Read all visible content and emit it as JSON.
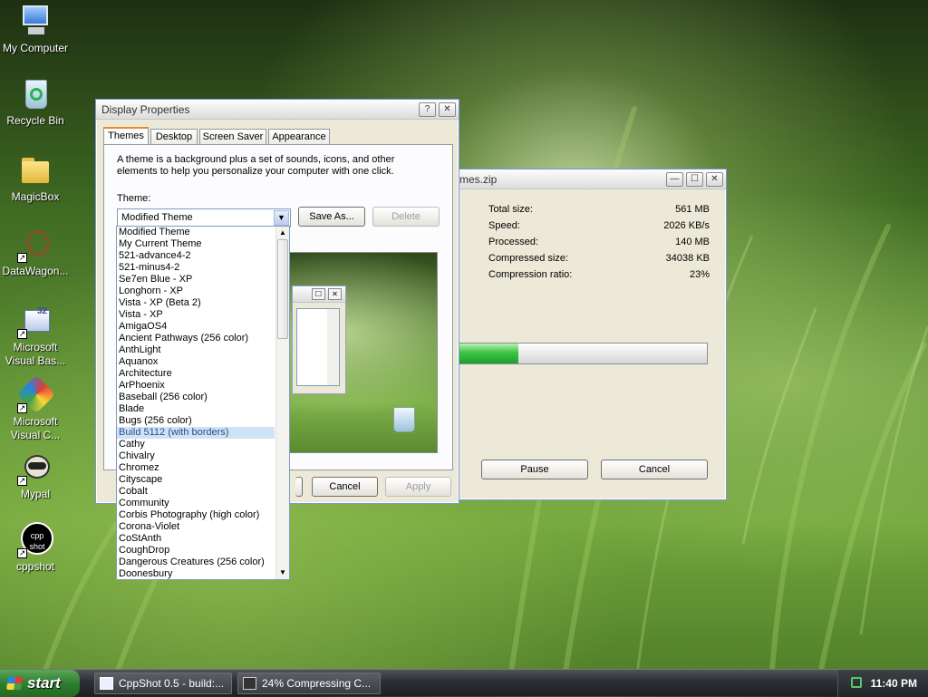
{
  "desktop": {
    "icons": [
      {
        "label": "My Computer"
      },
      {
        "label": "Recycle Bin"
      },
      {
        "label": "MagicBox"
      },
      {
        "label": "DataWagon..."
      },
      {
        "label": "Microsoft Visual Bas..."
      },
      {
        "label": "Microsoft Visual C..."
      },
      {
        "label": "Mypal"
      },
      {
        "label": "cppshot"
      }
    ]
  },
  "compress_window": {
    "title": "mes.zip",
    "stats": [
      {
        "label": "Total size:",
        "value": "561 MB"
      },
      {
        "label": "Speed:",
        "value": "2026 KB/s"
      },
      {
        "label": "Processed:",
        "value": "140 MB"
      },
      {
        "label": "Compressed size:",
        "value": "34038 KB"
      },
      {
        "label": "Compression ratio:",
        "value": "23%"
      }
    ],
    "progress": 0.24,
    "pause_label": "Pause",
    "cancel_label": "Cancel"
  },
  "display_properties": {
    "title": "Display Properties",
    "help_btn": "?",
    "close_btn": "✕",
    "tabs": [
      {
        "label": "Themes",
        "active": true
      },
      {
        "label": "Desktop"
      },
      {
        "label": "Screen Saver"
      },
      {
        "label": "Appearance"
      }
    ],
    "description": "A theme is a background plus a set of sounds, icons, and other elements to help you personalize your computer with one click.",
    "theme_label": "Theme:",
    "theme_selected": "Modified Theme",
    "save_as_label": "Save As...",
    "delete_label": "Delete",
    "cancel_label": "Cancel",
    "apply_label": "Apply",
    "theme_options": [
      "Modified Theme",
      "My Current Theme",
      "521-advance4-2",
      "521-minus4-2",
      "Se7en Blue - XP",
      "Longhorn - XP",
      "Vista - XP (Beta 2)",
      "Vista - XP",
      "AmigaOS4",
      "Ancient Pathways (256 color)",
      "AnthLight",
      "Aquanox",
      "Architecture",
      "ArPhoenix",
      "Baseball (256 color)",
      "Blade",
      "Bugs (256 color)",
      "Build 5112 (with borders)",
      "Cathy",
      "Chivalry",
      "Chromez",
      "Cityscape",
      "Cobalt",
      "Community",
      "Corbis Photography (high color)",
      "Corona-Violet",
      "CoStAnth",
      "CoughDrop",
      "Dangerous Creatures (256 color)",
      "Doonesbury"
    ],
    "highlighted_index": 17
  },
  "taskbar": {
    "start_label": "start",
    "tasks": [
      {
        "label": "CppShot 0.5 - build:..."
      },
      {
        "label": "24% Compressing C..."
      }
    ],
    "clock": "11:40 PM"
  },
  "colors": {
    "progress_fill": "#3cc447",
    "selection": "#cfe3f7"
  }
}
